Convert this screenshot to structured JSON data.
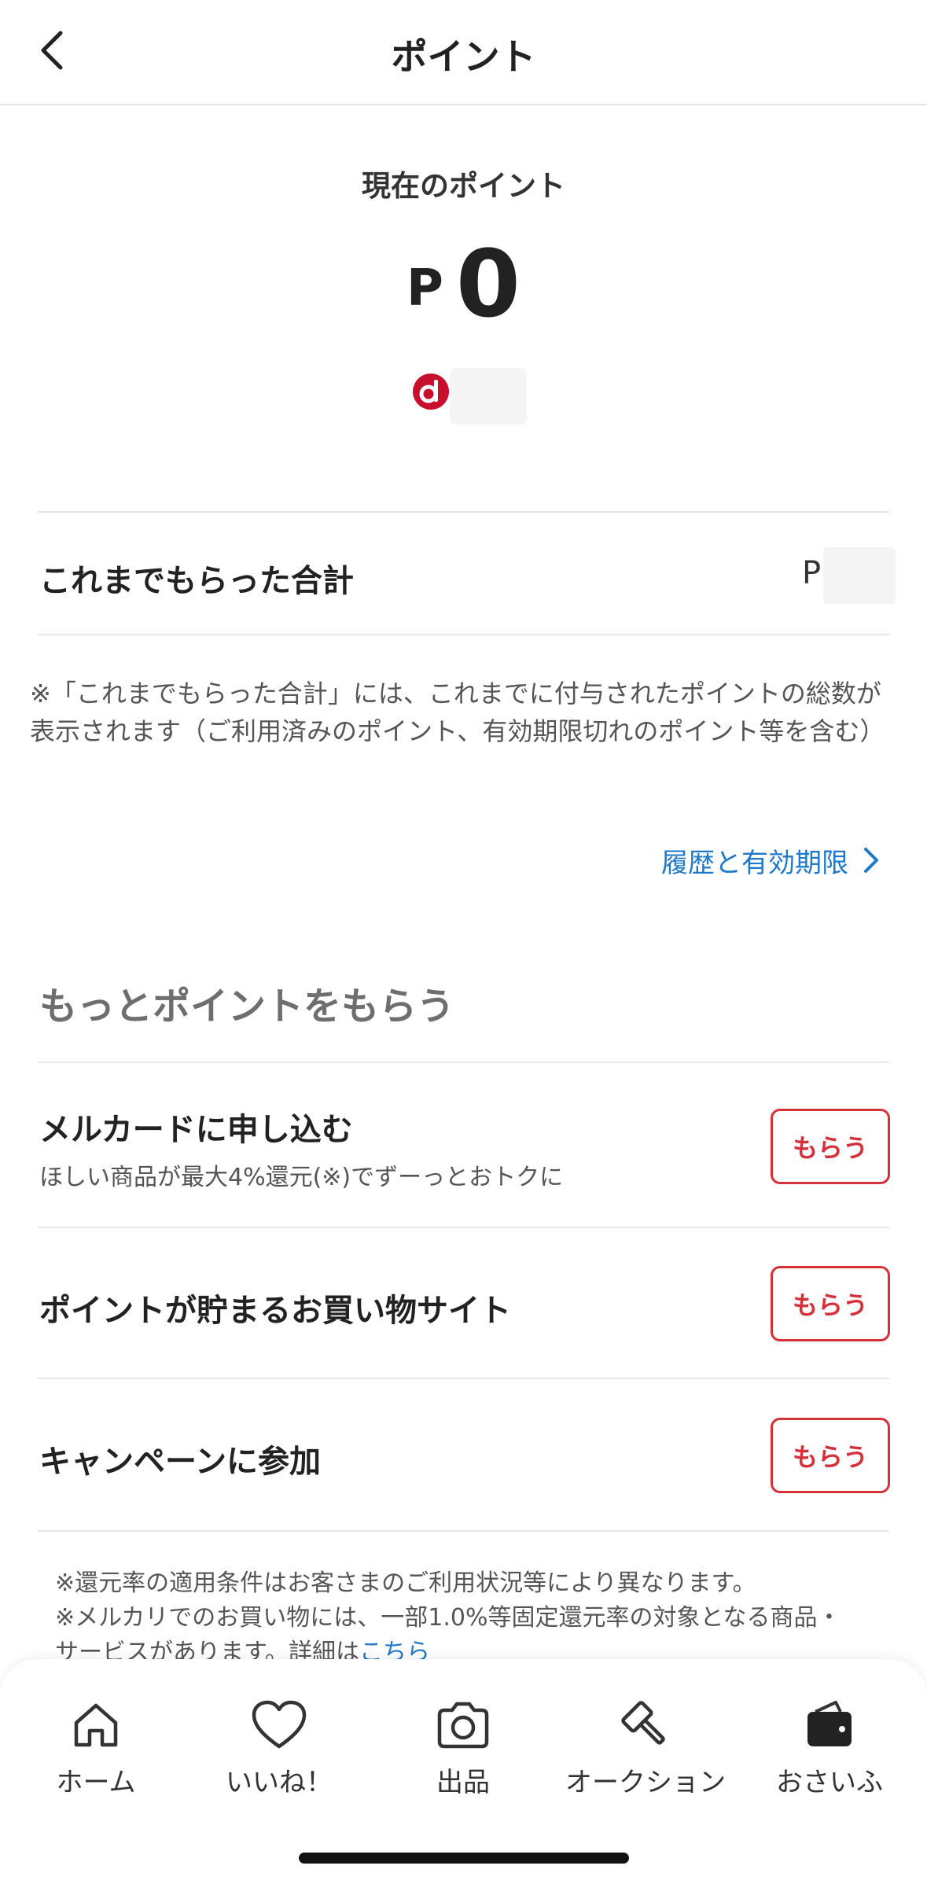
{
  "header": {
    "title": "ポイント"
  },
  "current": {
    "label": "現在のポイント",
    "prefix": "P",
    "value": "0",
    "dlogo_letter": "d"
  },
  "total": {
    "label": "これまでもらった合計",
    "prefix": "P"
  },
  "note": "※「これまでもらった合計」には、これまでに付与されたポイントの総数が表示されます（ご利用済みのポイント、有効期限切れのポイント等を含む）",
  "history_link": "履歴と有効期限",
  "more_section": {
    "title": "もっとポイントをもらう",
    "items": [
      {
        "title": "メルカードに申し込む",
        "subtitle": "ほしい商品が最大4%還元(※)でずーっとおトクに",
        "button": "もらう"
      },
      {
        "title": "ポイントが貯まるお買い物サイト",
        "button": "もらう"
      },
      {
        "title": "キャンペーンに参加",
        "button": "もらう"
      }
    ]
  },
  "footnotes": {
    "line1": "※還元率の適用条件はお客さまのご利用状況等により異なります。",
    "line2": "※メルカリでのお買い物には、一部1.0%等固定還元率の対象となる商品・",
    "line3_text": "サービスがあります。詳細は",
    "line3_link": "こちら"
  },
  "nav": {
    "items": [
      {
        "label": "ホーム",
        "icon": "home-icon"
      },
      {
        "label": "いいね！",
        "icon": "heart-icon"
      },
      {
        "label": "出品",
        "icon": "camera-icon"
      },
      {
        "label": "オークション",
        "icon": "gavel-icon"
      },
      {
        "label": "おさいふ",
        "icon": "wallet-icon"
      }
    ]
  },
  "colors": {
    "accent_red": "#d6313b",
    "link_blue": "#1f78c8",
    "dlogo_red": "#c8102e"
  }
}
